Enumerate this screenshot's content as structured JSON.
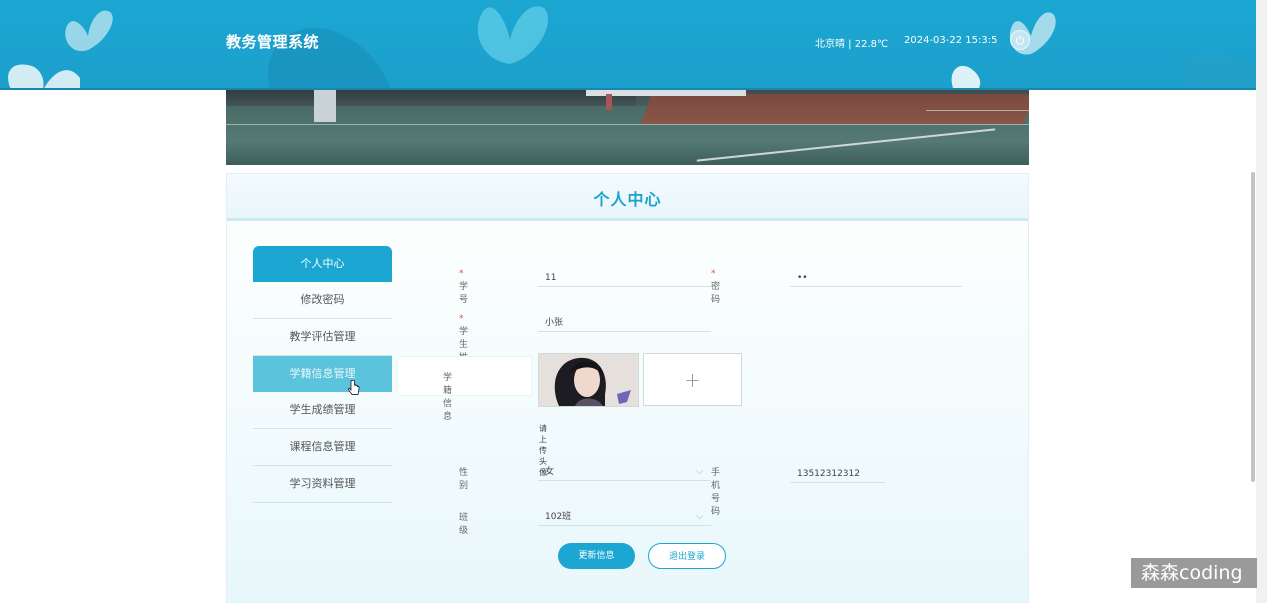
{
  "header": {
    "app_title": "教务管理系统",
    "weather": "北京晴 | 22.8℃",
    "datetime": "2024-03-22  15:3:5",
    "logout_icon": "power-icon"
  },
  "page_title": "个人中心",
  "sidebar": {
    "items": [
      {
        "label": "个人中心",
        "state": "active"
      },
      {
        "label": "修改密码",
        "state": "normal"
      },
      {
        "label": "教学评估管理",
        "state": "normal"
      },
      {
        "label": "学籍信息管理",
        "state": "hover"
      },
      {
        "label": "学生成绩管理",
        "state": "normal"
      },
      {
        "label": "课程信息管理",
        "state": "normal"
      },
      {
        "label": "学习资料管理",
        "state": "normal"
      }
    ]
  },
  "form": {
    "student_id": {
      "label": "学号",
      "required": "*",
      "value": "11"
    },
    "password": {
      "label": "密码",
      "required": "*",
      "value": "••"
    },
    "student_name": {
      "label": "学生姓名",
      "required": "*",
      "value": "小张"
    },
    "status_info": {
      "label": "学籍信息"
    },
    "avatar_hint": "请上传头像",
    "upload_symbol": "+",
    "gender": {
      "label": "性别",
      "value": "女"
    },
    "phone": {
      "label": "手机号码",
      "value": "13512312312"
    },
    "class": {
      "label": "班级",
      "value": "102班"
    }
  },
  "buttons": {
    "update": "更新信息",
    "logout": "退出登录"
  },
  "watermark": "森森coding",
  "colors": {
    "primary": "#1ba7d2",
    "hover": "#5bc3dc",
    "required": "#e24c4c"
  }
}
